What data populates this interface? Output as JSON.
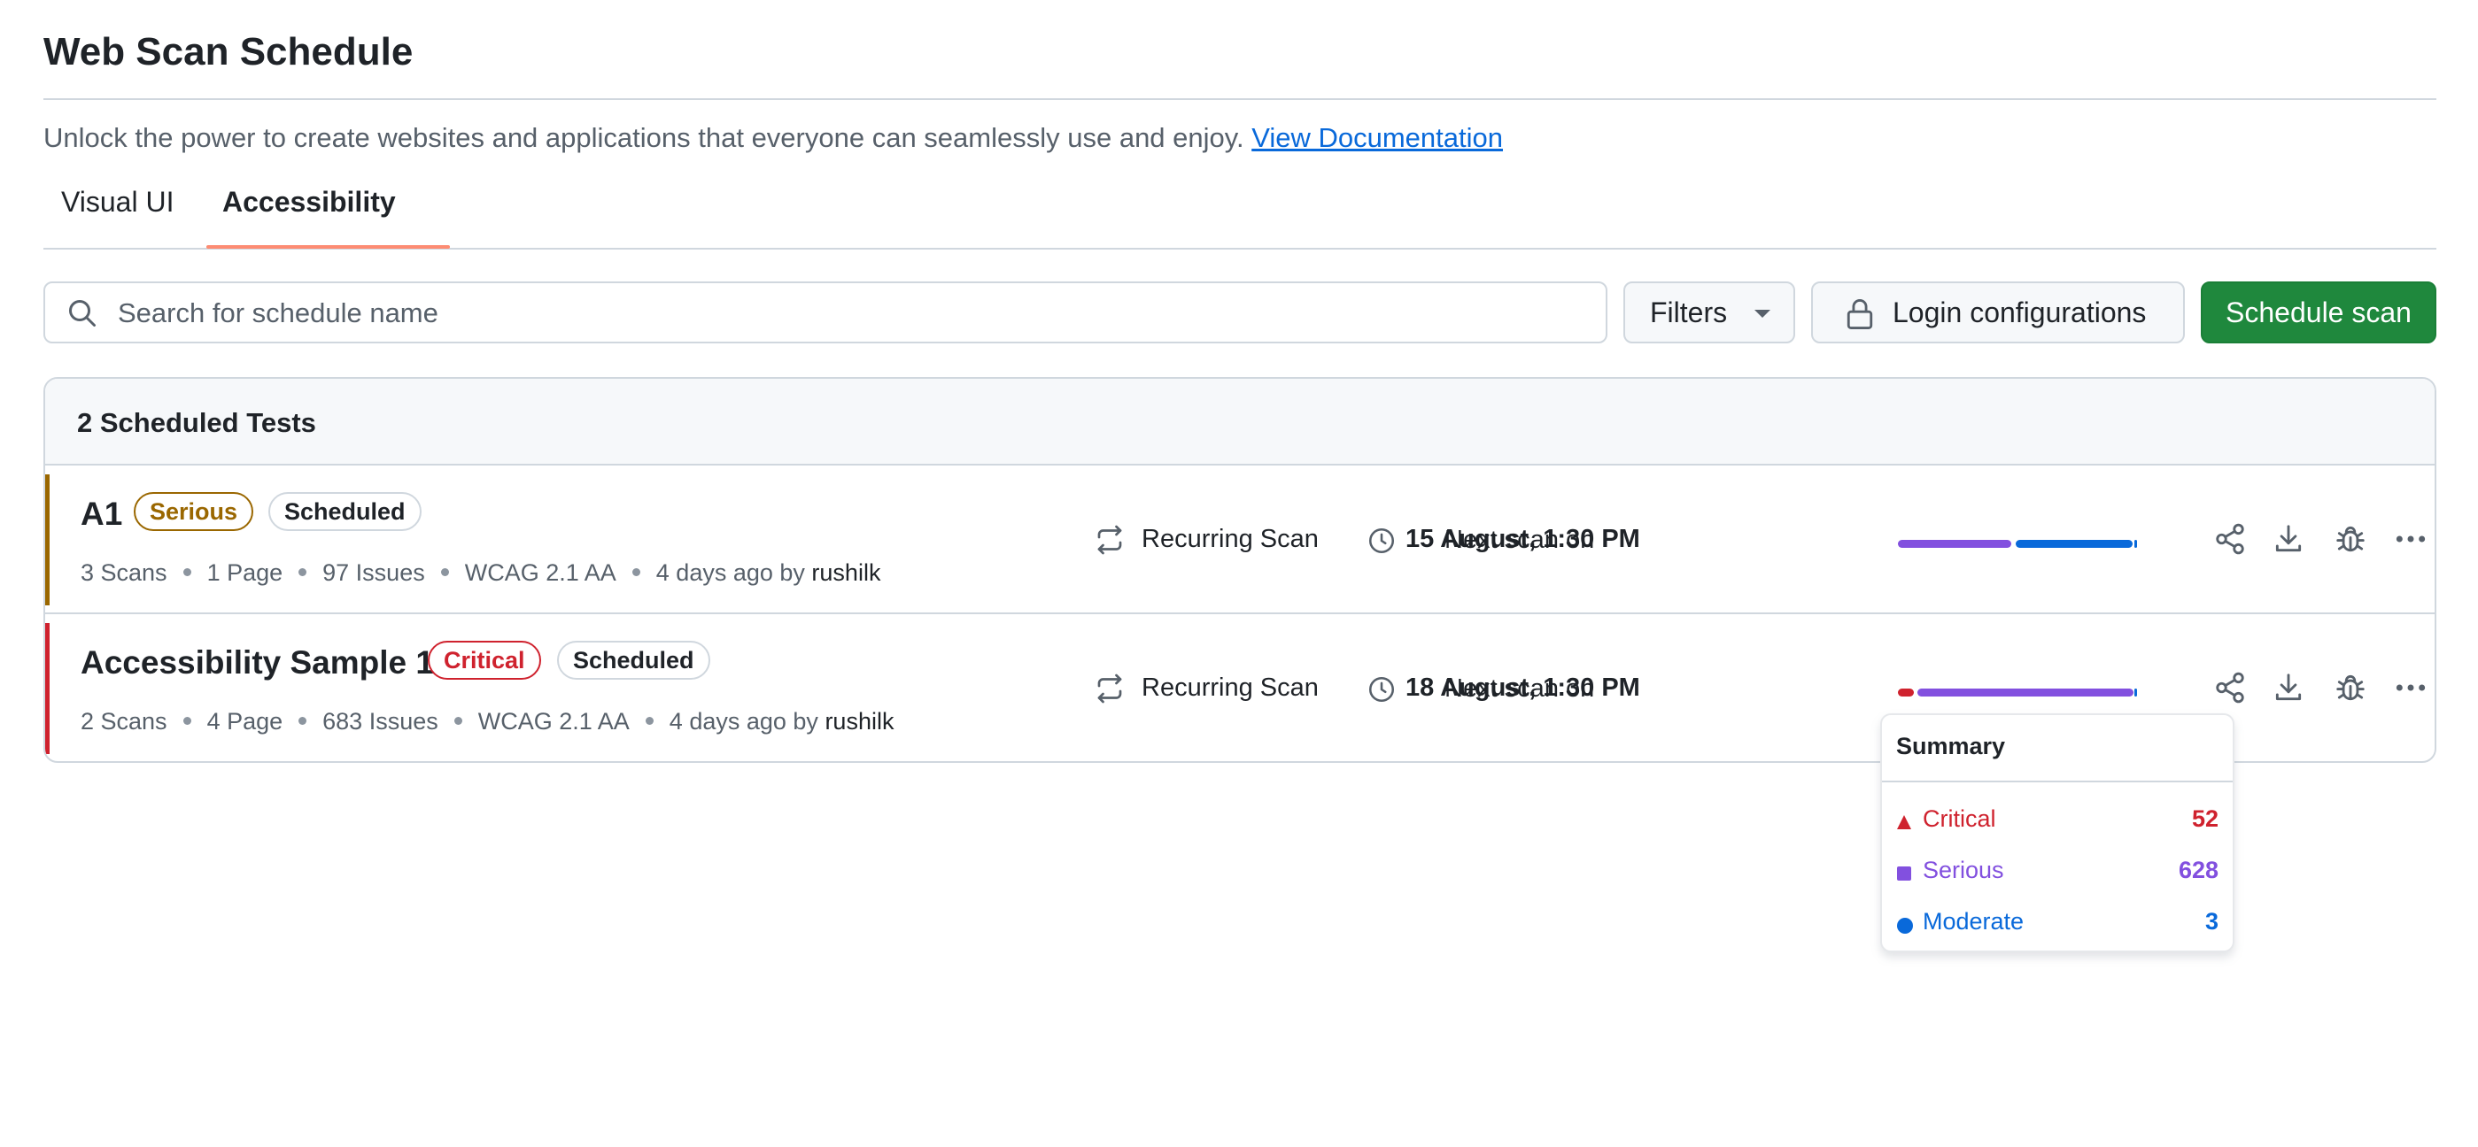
{
  "page": {
    "title": "Web Scan Schedule",
    "description": "Unlock the power to create websites and applications that everyone can seamlessly use and enjoy.",
    "doc_link": "View Documentation"
  },
  "tabs": [
    {
      "label": "Visual UI",
      "active": false
    },
    {
      "label": "Accessibility",
      "active": true
    }
  ],
  "toolbar": {
    "search_placeholder": "Search for schedule name",
    "filters_label": "Filters",
    "login_label": "Login configurations",
    "schedule_label": "Schedule scan"
  },
  "list": {
    "header": "2 Scheduled Tests",
    "rows": [
      {
        "name": "A1",
        "severity": "Serious",
        "status": "Scheduled",
        "scans": "3 Scans",
        "pages": "1 Page",
        "issues": "97 Issues",
        "standard": "WCAG 2.1 AA",
        "time": "4 days ago by",
        "user": "rushilk",
        "recurring": "Recurring Scan",
        "next_prefix": "Next scan on",
        "next_date": "15 August, 1:30 PM",
        "distribution": {
          "critical": 0,
          "serious": 0.48,
          "moderate": 0.5,
          "minor": 0.02
        }
      },
      {
        "name": "Accessibility Sample 1",
        "severity": "Critical",
        "status": "Scheduled",
        "scans": "2 Scans",
        "pages": "4 Page",
        "issues": "683 Issues",
        "standard": "WCAG 2.1 AA",
        "time": "4 days ago by",
        "user": "rushilk",
        "recurring": "Recurring Scan",
        "next_prefix": "Next scan on",
        "next_date": "18 August, 1:30 PM",
        "distribution": {
          "critical": 52,
          "serious": 628,
          "moderate": 3
        }
      }
    ]
  },
  "summary_popover": {
    "title": "Summary",
    "items": [
      {
        "label": "Critical",
        "value": "52",
        "color": "#cf222e"
      },
      {
        "label": "Serious",
        "value": "628",
        "color": "#8250df"
      },
      {
        "label": "Moderate",
        "value": "3",
        "color": "#0969da"
      }
    ]
  },
  "colors": {
    "accent_tab": "#fd8c73",
    "primary_button": "#1f883d",
    "critical": "#cf222e",
    "serious": "#8250df",
    "serious_badge": "#9a6700",
    "moderate": "#0969da",
    "link": "#0969da"
  },
  "icons": {
    "search": "search-icon",
    "lock": "lock-icon",
    "recurring": "repeat-icon",
    "clock": "clock-icon",
    "share": "share-icon",
    "download": "download-icon",
    "bug": "bug-icon",
    "more": "kebab-horizontal-icon"
  }
}
